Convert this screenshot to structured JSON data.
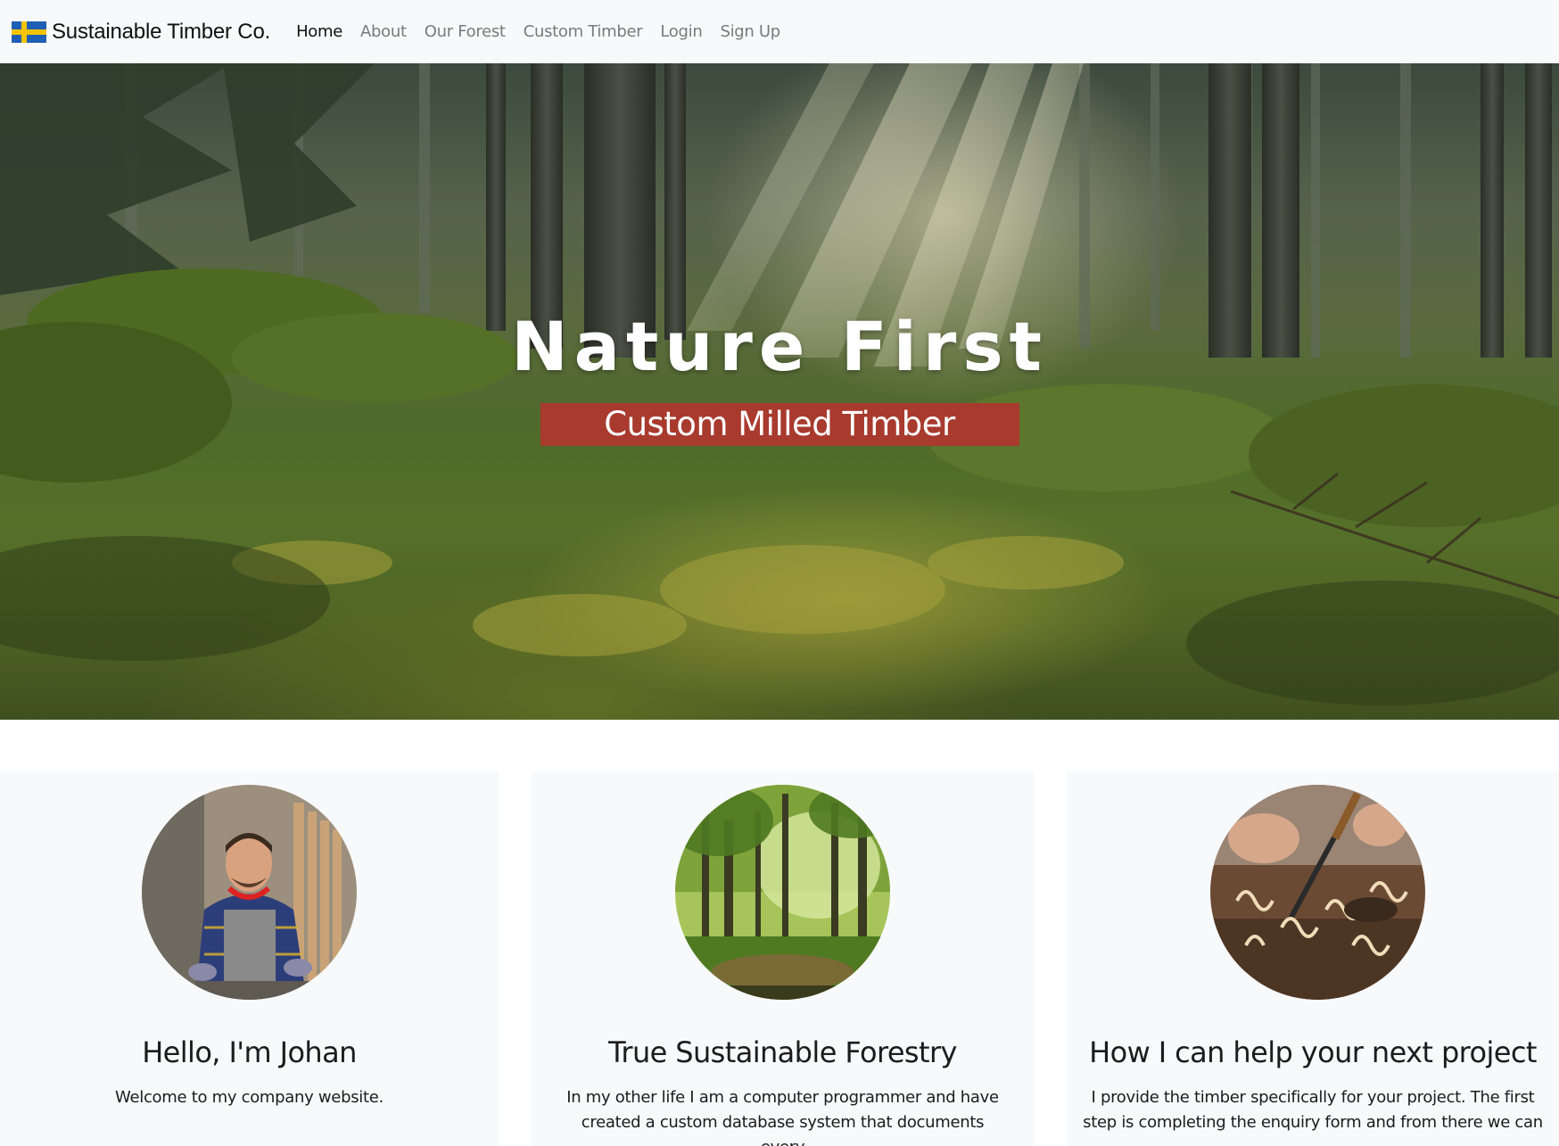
{
  "brand": {
    "name": "Sustainable Timber Co.",
    "flag_icon": "sweden-flag-icon"
  },
  "nav": {
    "items": [
      {
        "label": "Home",
        "active": true
      },
      {
        "label": "About",
        "active": false
      },
      {
        "label": "Our Forest",
        "active": false
      },
      {
        "label": "Custom Timber",
        "active": false
      },
      {
        "label": "Login",
        "active": false
      },
      {
        "label": "Sign Up",
        "active": false
      }
    ]
  },
  "hero": {
    "title": "Nature First",
    "subtitle": "Custom Milled Timber",
    "background_image": "misty-forest-sunbeams-photo"
  },
  "cards": [
    {
      "image": "smiling-carpenter-photo",
      "title": "Hello, I'm Johan",
      "text": "Welcome to my company website."
    },
    {
      "image": "green-forest-photo",
      "title": "True Sustainable Forestry",
      "text": "In my other life I am a computer programmer and have created a custom database system that documents every"
    },
    {
      "image": "wood-carving-chisel-photo",
      "title": "How I can help your next project",
      "text": "I provide the timber specifically for your project. The first step is completing the enquiry form and from there we can"
    }
  ],
  "colors": {
    "navbar_bg": "#f8f9fa",
    "card_bg": "#f8f9fa",
    "subtitle_bg": "#a83a2e",
    "flag_blue": "#1f5fb4",
    "flag_yellow": "#f5c400"
  }
}
